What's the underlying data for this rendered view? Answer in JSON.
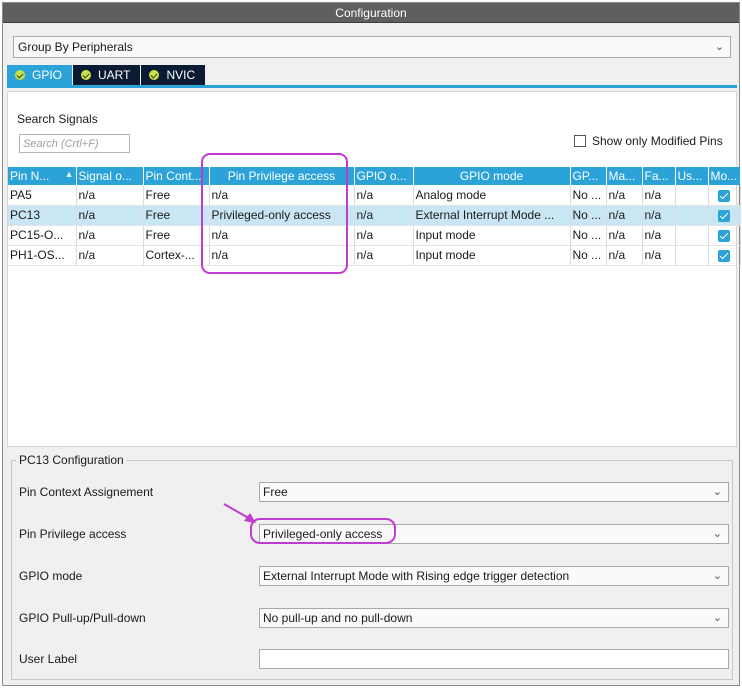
{
  "window": {
    "title": "Configuration"
  },
  "grouping": {
    "selected": "Group By Peripherals"
  },
  "tabs": [
    {
      "label": "GPIO",
      "active": true
    },
    {
      "label": "UART",
      "active": false
    },
    {
      "label": "NVIC",
      "active": false
    }
  ],
  "search": {
    "title": "Search Signals",
    "placeholder": "Search (Crtl+F)",
    "value": ""
  },
  "filter": {
    "label": "Show only Modified Pins",
    "checked": false
  },
  "table": {
    "columns": [
      "Pin N...",
      "Signal o...",
      "Pin Cont...",
      "Pin Privilege access",
      "GPIO o...",
      "GPIO mode",
      "GP...",
      "Ma...",
      "Fa...",
      "Us...",
      "Mo..."
    ],
    "rows": [
      {
        "pin": "PA5",
        "signal": "n/a",
        "context": "Free",
        "privilege": "n/a",
        "output": "n/a",
        "mode": "Analog mode",
        "pull": "No ...",
        "max": "n/a",
        "fast": "n/a",
        "user": "",
        "modified": true
      },
      {
        "pin": "PC13",
        "signal": "n/a",
        "context": "Free",
        "privilege": "Privileged-only access",
        "output": "n/a",
        "mode": "External Interrupt Mode ...",
        "pull": "No ...",
        "max": "n/a",
        "fast": "n/a",
        "user": "",
        "modified": true
      },
      {
        "pin": "PC15-O...",
        "signal": "n/a",
        "context": "Free",
        "privilege": "n/a",
        "output": "n/a",
        "mode": "Input mode",
        "pull": "No ...",
        "max": "n/a",
        "fast": "n/a",
        "user": "",
        "modified": true
      },
      {
        "pin": "PH1-OS...",
        "signal": "n/a",
        "context": "Cortex-...",
        "privilege": "n/a",
        "output": "n/a",
        "mode": "Input mode",
        "pull": "No ...",
        "max": "n/a",
        "fast": "n/a",
        "user": "",
        "modified": true
      }
    ]
  },
  "pin_config": {
    "title": "PC13 Configuration",
    "fields": [
      {
        "label": "Pin Context Assignement",
        "value": "Free"
      },
      {
        "label": "Pin Privilege access",
        "value": "Privileged-only access"
      },
      {
        "label": "GPIO mode",
        "value": "External Interrupt Mode with Rising edge trigger detection"
      },
      {
        "label": "GPIO Pull-up/Pull-down",
        "value": "No pull-up and no pull-down"
      },
      {
        "label": "User Label",
        "value": ""
      }
    ]
  },
  "colors": {
    "accent": "#2ba3d9",
    "highlight": "#c03bd0",
    "titlebar": "#5f5f5f",
    "tab_inactive": "#0b1b33"
  }
}
